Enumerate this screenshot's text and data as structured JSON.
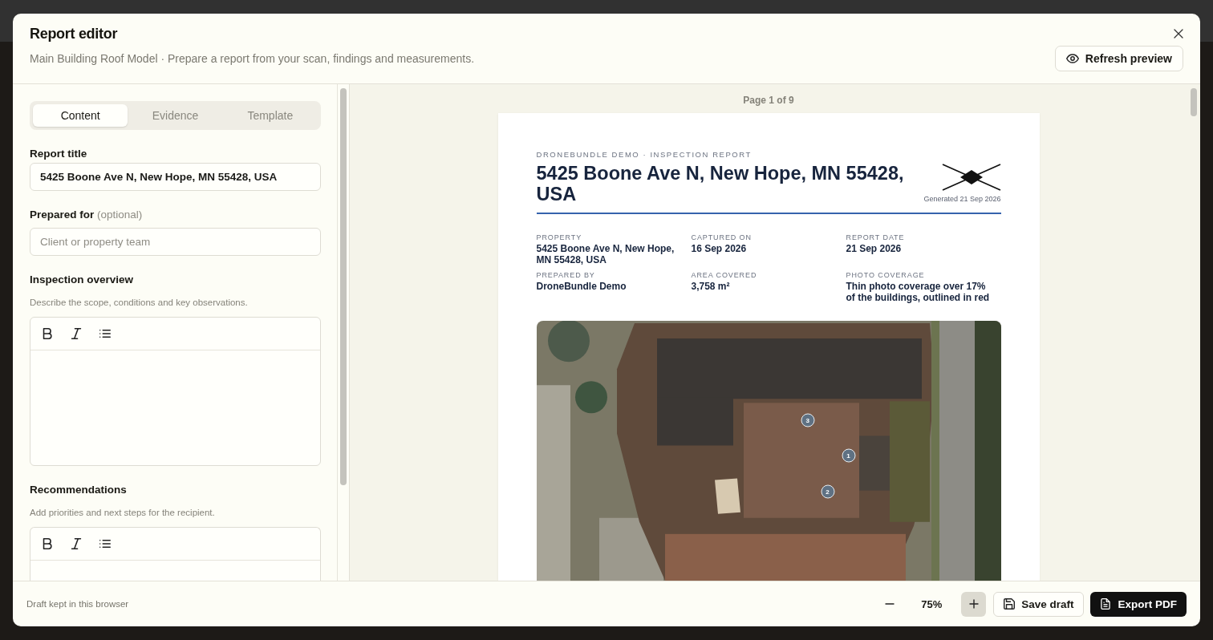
{
  "dialog": {
    "title": "Report editor",
    "subtitle": "Main Building Roof Model · Prepare a report from your scan, findings and measurements.",
    "refresh_button": "Refresh preview"
  },
  "tabs": [
    {
      "label": "Content",
      "selected": true
    },
    {
      "label": "Evidence",
      "selected": false
    },
    {
      "label": "Template",
      "selected": false
    }
  ],
  "fields": [
    {
      "kind": "text",
      "label": "Report title",
      "value": "5425 Boone Ave N, New Hope, MN 55428, USA"
    },
    {
      "kind": "text",
      "label": "Prepared for",
      "note": "(optional)",
      "placeholder": "Client or property team"
    },
    {
      "kind": "rich",
      "label": "Inspection overview",
      "hint": "Describe the scope, conditions and key observations."
    },
    {
      "kind": "rich",
      "label": "Recommendations",
      "hint": "Add priorities and next steps for the recipient."
    }
  ],
  "preview": {
    "page_indicator": "Page 1 of 9",
    "kicker": "DRONEBUNDLE DEMO · INSPECTION REPORT",
    "title": "5425 Boone Ave N, New Hope, MN 55428, USA",
    "generated": "Generated 21 Sep 2026",
    "meta": [
      {
        "label": "PROPERTY",
        "value": "5425 Boone Ave N, New Hope, MN 55428, USA"
      },
      {
        "label": "CAPTURED ON",
        "value": "16 Sep 2026"
      },
      {
        "label": "REPORT DATE",
        "value": "21 Sep 2026"
      },
      {
        "label": "PREPARED BY",
        "value": "DroneBundle Demo"
      },
      {
        "label": "AREA COVERED",
        "value": "3,758 m²"
      },
      {
        "label": "PHOTO COVERAGE",
        "value": "Thin photo coverage over 17% of the buildings, outlined in red"
      }
    ],
    "markers": [
      "3",
      "1",
      "2"
    ]
  },
  "footer": {
    "status": "Draft kept in this browser",
    "zoom": "75%",
    "save_button": "Save draft",
    "export_button": "Export PDF"
  }
}
